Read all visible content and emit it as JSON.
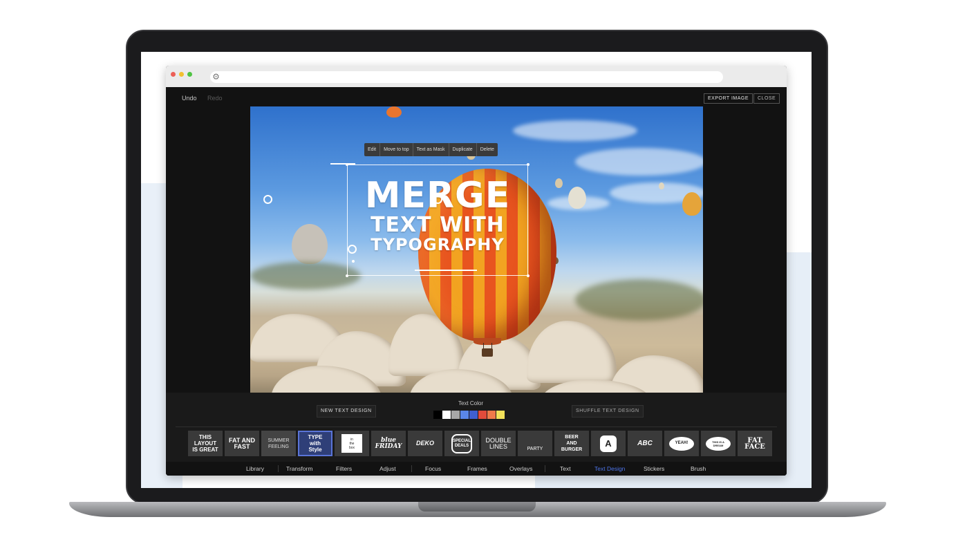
{
  "toolbar": {
    "undo": "Undo",
    "redo": "Redo",
    "export": "EXPORT IMAGE",
    "close": "CLOSE"
  },
  "context_menu": [
    "Edit",
    "Move to top",
    "Text as Mask",
    "Duplicate",
    "Delete"
  ],
  "overlay_text": {
    "line1": "MERGE",
    "line2": "TEXT WITH",
    "line3": "TYPOGRAPHY"
  },
  "panel": {
    "new_text_design": "NEW TEXT DESIGN",
    "text_color_label": "Text Color",
    "shuffle_text_design": "SHUFFLE TEXT DESIGN",
    "colors": [
      "#000000",
      "#ffffff",
      "#a7a7a7",
      "#5a86e8",
      "#3f5fd1",
      "#e24b3b",
      "#ef7a4a",
      "#f2e15a"
    ],
    "selected_color": "#ffffff"
  },
  "designs": [
    {
      "name": "this-layout",
      "text": "THIS\nLAYOUT\nIS GREAT"
    },
    {
      "name": "fat-and-fast",
      "text": "FAT AND\nFAST"
    },
    {
      "name": "summer-feeling",
      "text": "SUMMER\nFEELING"
    },
    {
      "name": "type-with-style",
      "text": "TYPE\nwith\nStyle"
    },
    {
      "name": "in-the-box",
      "text": "in\nthe\nbox"
    },
    {
      "name": "blue-friday",
      "text": "blue\nFRIDAY"
    },
    {
      "name": "deko",
      "text": "DEKO"
    },
    {
      "name": "special-deals",
      "text": "SPECIAL\nDEALS"
    },
    {
      "name": "double-lines",
      "text": "DOUBLE\nLINES"
    },
    {
      "name": "party",
      "text": "PARTY"
    },
    {
      "name": "beer-and-burger",
      "text": "BEER\nAND\nBURGER"
    },
    {
      "name": "letter-a",
      "text": "A"
    },
    {
      "name": "abc",
      "text": "ABC"
    },
    {
      "name": "yeah",
      "text": "YEAH!"
    },
    {
      "name": "this-is-a-dream",
      "text": "THIS IS A\nDREAM"
    },
    {
      "name": "fat-face",
      "text": "FAT\nFACE"
    }
  ],
  "nav": [
    "Library",
    "Transform",
    "Filters",
    "Adjust",
    "Focus",
    "Frames",
    "Overlays",
    "Text",
    "Text Design",
    "Stickers",
    "Brush"
  ],
  "nav_active": "Text Design",
  "icons": {
    "url_icon": "settings-gear-icon"
  }
}
